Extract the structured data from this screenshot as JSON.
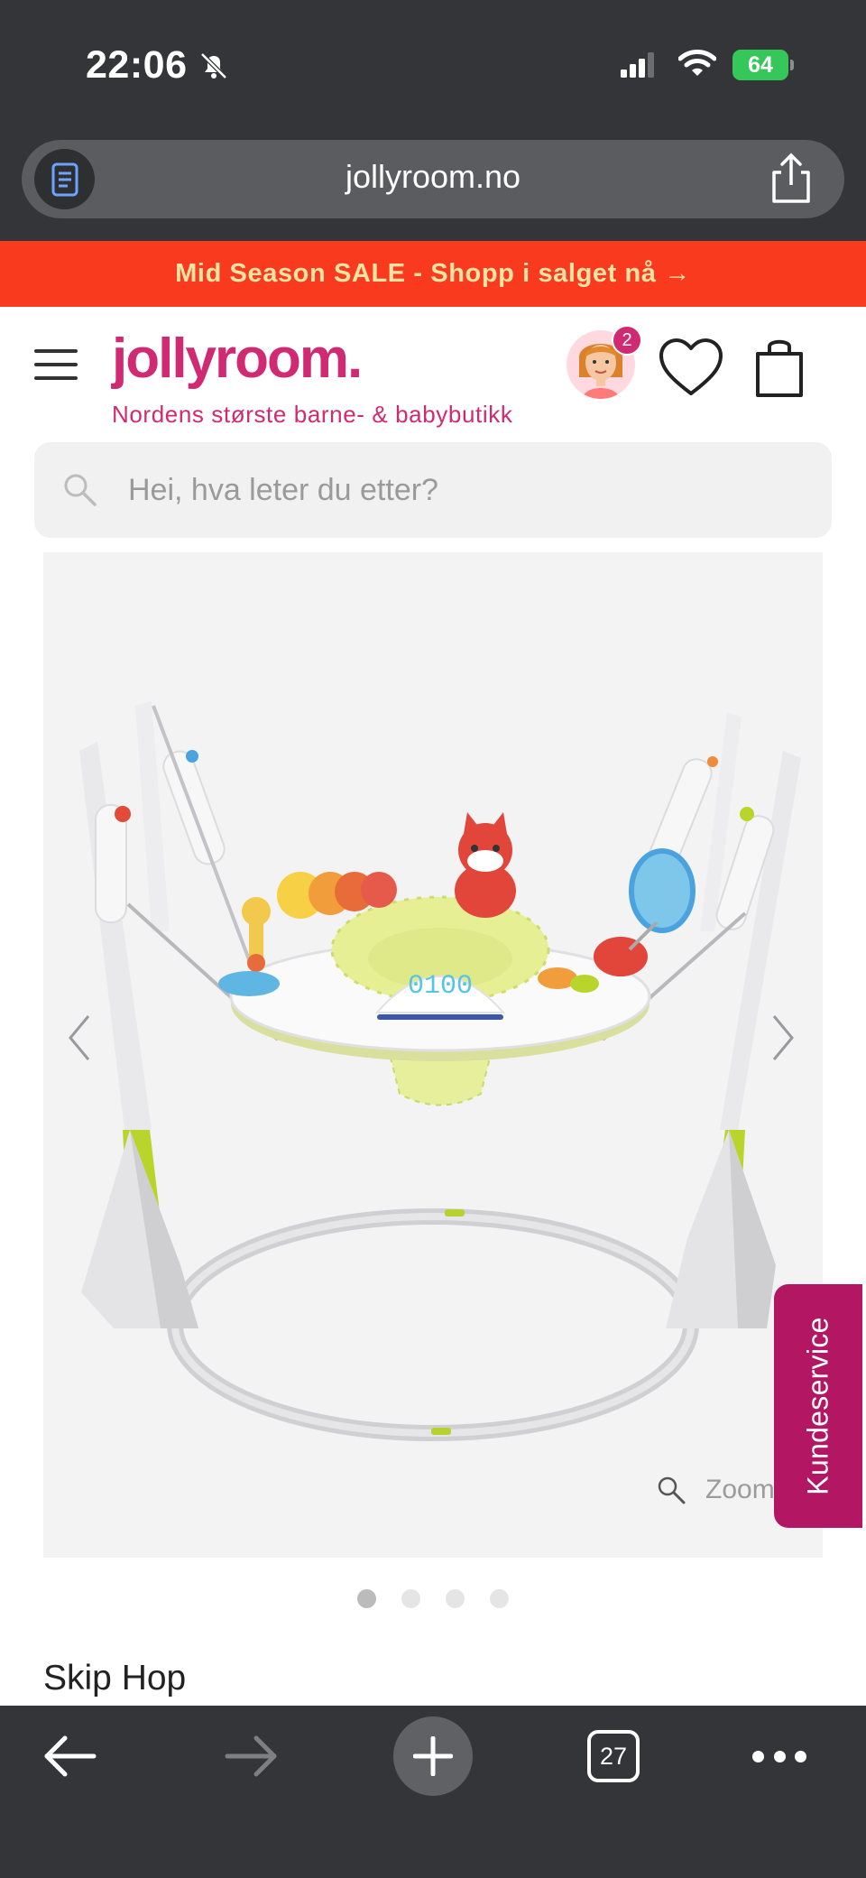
{
  "status_bar": {
    "time": "22:06",
    "battery": "64",
    "icons": [
      "bell-off-icon",
      "signal-icon",
      "wifi-icon",
      "battery-icon"
    ]
  },
  "browser": {
    "url": "jollyroom.no",
    "icons": [
      "reader-icon",
      "share-icon"
    ]
  },
  "promo_banner": {
    "text": "Mid Season SALE - Shopp i salget nå →",
    "background": "#fa3a1f",
    "text_color": "#ffe3a3"
  },
  "header": {
    "logo": "jollyroom.",
    "tagline": "Nordens største barne- & babybutikk",
    "profile_badge": "2",
    "brand_color": "#d02a72",
    "icons": [
      "menu-icon",
      "avatar",
      "heart-icon",
      "shopping-bag-icon"
    ]
  },
  "search": {
    "placeholder": "Hei, hva leter du etter?",
    "value": ""
  },
  "product": {
    "image_alt": "Skip Hop activity jumper",
    "display_readout": "0100",
    "zoom_label": "Zoom",
    "carousel": {
      "count": 4,
      "active_index": 0
    },
    "brand": "Skip Hop"
  },
  "support_tab": {
    "label": "Kundeservice",
    "color": "#b31662"
  },
  "bottom_toolbar": {
    "tab_count": "27",
    "icons": [
      "back-arrow-icon",
      "forward-arrow-icon",
      "plus-icon",
      "tabs-icon",
      "more-icon"
    ]
  }
}
